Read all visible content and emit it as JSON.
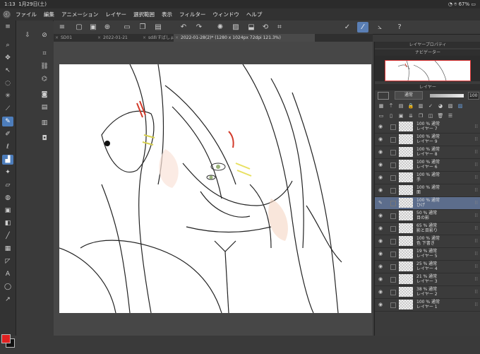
{
  "status": {
    "time": "1:13",
    "date": "1月29日(土)",
    "battery": "67%"
  },
  "menu": [
    "ファイル",
    "編集",
    "アニメーション",
    "レイヤー",
    "選択範囲",
    "表示",
    "フィルター",
    "ウィンドウ",
    "ヘルプ"
  ],
  "tabs": [
    {
      "label": "SD01",
      "active": false
    },
    {
      "label": "2022-01-21",
      "active": false
    },
    {
      "label": "sdおすばしょ",
      "active": false
    },
    {
      "label": "2022-01-28(2)* (1280 x 1024px 72dpi 121.3%)",
      "active": true
    }
  ],
  "panels": {
    "layer_property": "レイヤープロパティ",
    "navigator": "ナビゲーター",
    "layer": "レイヤー"
  },
  "layer_controls": {
    "blend_mode": "通常",
    "opacity": "100"
  },
  "layers": [
    {
      "line1": "100 % 通常",
      "line2": "レイヤー 7",
      "selected": false
    },
    {
      "line1": "100 % 通常",
      "line2": "レイヤー 9",
      "selected": false
    },
    {
      "line1": "100 % 通常",
      "line2": "レイヤー 8",
      "selected": false
    },
    {
      "line1": "100 % 通常",
      "line2": "レイヤー 6",
      "selected": false
    },
    {
      "line1": "100 % 通常",
      "line2": "手",
      "selected": false
    },
    {
      "line1": "100 % 通常",
      "line2": "面",
      "selected": false
    },
    {
      "line1": "100 % 通常",
      "line2": "ひげ",
      "selected": true
    },
    {
      "line1": "50 % 通常",
      "line2": "目の影",
      "selected": false
    },
    {
      "line1": "65 % 通常",
      "line2": "影と目影り",
      "selected": false
    },
    {
      "line1": "100 % 通常",
      "line2": "色 下書き",
      "selected": false
    },
    {
      "line1": "19 % 通常",
      "line2": "レイヤー 5",
      "selected": false
    },
    {
      "line1": "25 % 通常",
      "line2": "レイヤー 4",
      "selected": false
    },
    {
      "line1": "21 % 通常",
      "line2": "レイヤー 3",
      "selected": false
    },
    {
      "line1": "38 % 通常",
      "line2": "レイヤー 2",
      "selected": false
    },
    {
      "line1": "100 % 通常",
      "line2": "レイヤー 1",
      "selected": false
    }
  ],
  "colors": {
    "main": "#e02020",
    "sub": "#111111",
    "accent": "#5a7fb5"
  }
}
